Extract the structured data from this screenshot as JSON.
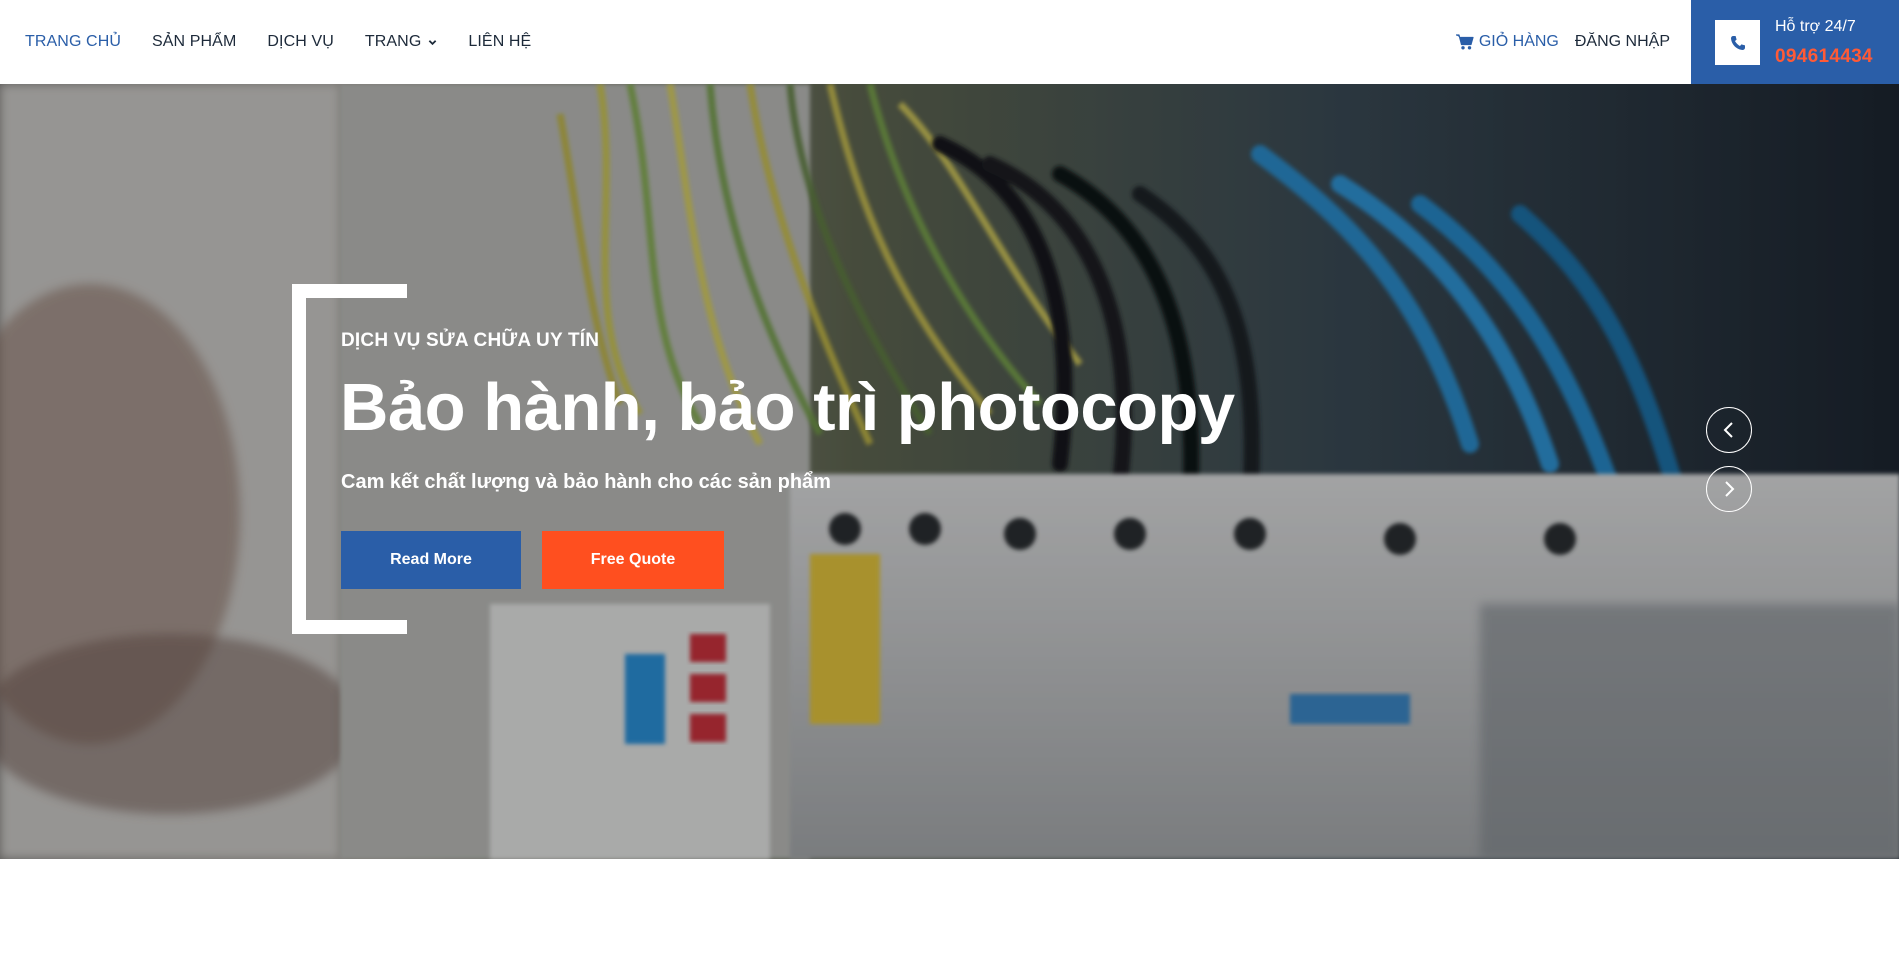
{
  "nav": {
    "items": [
      {
        "label": "TRANG CHỦ",
        "active": true
      },
      {
        "label": "SẢN PHẨM"
      },
      {
        "label": "DỊCH VỤ"
      },
      {
        "label": "TRANG",
        "dropdown": true
      },
      {
        "label": "LIÊN HỆ"
      }
    ]
  },
  "header": {
    "cart_label": "GIỎ HÀNG",
    "login_label": "ĐĂNG NHẬP",
    "support_label": "Hỗ trợ 24/7",
    "support_phone": "094614434"
  },
  "hero": {
    "eyebrow": "DỊCH VỤ SỬA CHỮA UY TÍN",
    "headline": "Bảo hành, bảo trì photocopy",
    "subline": "Cam kết chất lượng và bảo hành cho các sản phẩm",
    "read_more_label": "Read More",
    "free_quote_label": "Free Quote"
  },
  "colors": {
    "primary": "#2a5ea8",
    "accent": "#ff4f1f",
    "phone_number": "#ff5a36",
    "nav_text": "#1d2a3a"
  },
  "icons": {
    "cart": "shopping-cart-icon",
    "phone": "phone-icon",
    "dropdown": "chevron-down-icon",
    "prev": "chevron-left-icon",
    "next": "chevron-right-icon"
  }
}
